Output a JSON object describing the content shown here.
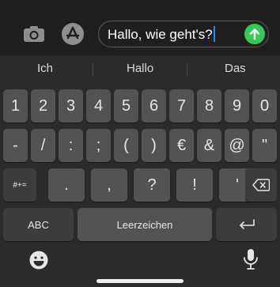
{
  "message_bar": {
    "input_value": "Hallo, wie geht's?",
    "send_color": "#35c759",
    "icons": [
      "camera-icon",
      "app-store-icon",
      "send-arrow-icon"
    ]
  },
  "predictions": [
    "Ich",
    "Hallo",
    "Das"
  ],
  "keyboard": {
    "number_row": [
      "1",
      "2",
      "3",
      "4",
      "5",
      "6",
      "7",
      "8",
      "9",
      "0"
    ],
    "symbol_row": [
      "-",
      "/",
      ":",
      ";",
      "(",
      ")",
      "€",
      "&",
      "@",
      "\""
    ],
    "punct_row": {
      "toggle": "#+=",
      "keys": [
        ".",
        ",",
        "?",
        "!",
        "'"
      ],
      "delete_icon": "backspace-icon"
    },
    "bottom_row": {
      "abc": "ABC",
      "space": "Leerzeichen",
      "return_icon": "return-icon"
    },
    "footer": {
      "emoji_icon": "emoji-icon",
      "mic_icon": "microphone-icon"
    }
  }
}
